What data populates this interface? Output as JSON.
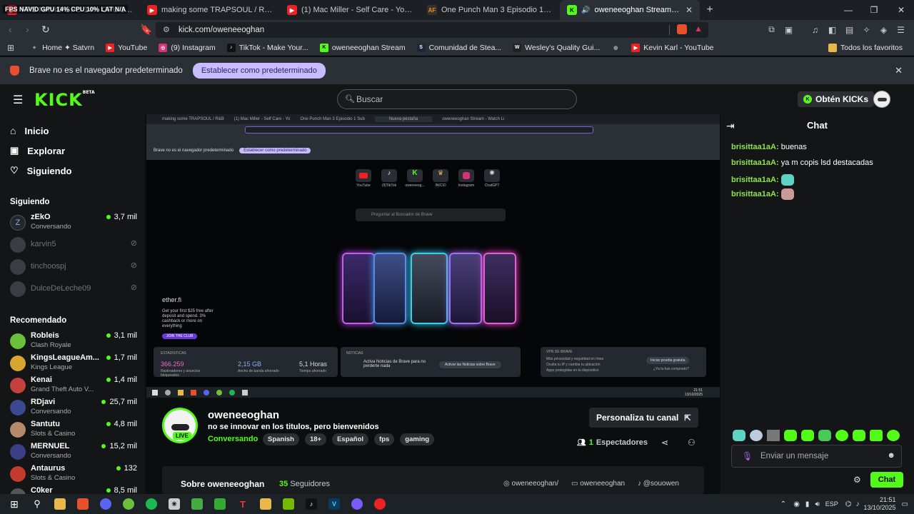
{
  "browser": {
    "tabs": [
      {
        "title": "FPS NAVID GPU 14% CPU 10% LAT N/A — BOUNCY BLLTZ - YouTube",
        "color": "#e22"
      },
      {
        "title": "making some TRAPSOUL / R&B - YouTube",
        "color": "#e22"
      },
      {
        "title": "(1) Mac Miller - Self Care - YouTube",
        "color": "#e22"
      },
      {
        "title": "One Punch Man 3 Episodio 1 Sub Esp",
        "color": "#555"
      },
      {
        "title": "oweneeoghan Stream - Watch Live on Kick",
        "color": "#53fc18"
      }
    ],
    "overlay_text": "FPS NAVID GPU 14% CPU 10% LAT N/A",
    "url": "kick.com/oweneeoghan",
    "bookmarks": [
      {
        "label": "Home ✦ Satvrn",
        "color": "#7a5"
      },
      {
        "label": "YouTube",
        "color": "#e22"
      },
      {
        "label": "(9) Instagram",
        "color": "#d3337a"
      },
      {
        "label": "TikTok - Make Your...",
        "color": "#111"
      },
      {
        "label": "oweneeoghan Stream",
        "color": "#53fc18"
      },
      {
        "label": "Comunidad de Stea...",
        "color": "#1b2838"
      },
      {
        "label": "Wesley's Quality Gui...",
        "color": "#222"
      },
      {
        "label": "",
        "color": "#555"
      },
      {
        "label": "Kevin Karl - YouTube",
        "color": "#e22"
      }
    ],
    "bookmarks_folder": "Todos los favoritos",
    "infobar_text": "Brave no es el navegador predeterminado",
    "infobar_button": "Establecer como predeterminado"
  },
  "kick": {
    "logo": "KICK",
    "logo_badge": "BETA",
    "search_placeholder": "Buscar",
    "get_kicks": "Obtén KICKs",
    "nav": [
      {
        "label": "Inicio",
        "icon": "home-icon"
      },
      {
        "label": "Explorar",
        "icon": "compass-icon"
      },
      {
        "label": "Siguiendo",
        "icon": "heart-icon"
      }
    ],
    "following_title": "Siguiendo",
    "following": [
      {
        "name": "zEkO",
        "category": "Conversando",
        "viewers": "3,7 mil",
        "online": true
      },
      {
        "name": "karvin5",
        "category": "",
        "viewers": "",
        "online": false
      },
      {
        "name": "tinchoospj",
        "category": "",
        "viewers": "",
        "online": false
      },
      {
        "name": "DulceDeLeche09",
        "category": "",
        "viewers": "",
        "online": false
      }
    ],
    "recommended_title": "Recomendado",
    "recommended": [
      {
        "name": "Robleis",
        "category": "Clash Royale",
        "viewers": "3,1 mil"
      },
      {
        "name": "KingsLeagueAm...",
        "category": "Kings League",
        "viewers": "1,7 mil"
      },
      {
        "name": "Kenai",
        "category": "Grand Theft Auto V...",
        "viewers": "1,4 mil"
      },
      {
        "name": "RDjavi",
        "category": "Conversando",
        "viewers": "25,7 mil"
      },
      {
        "name": "Santutu",
        "category": "Slots & Casino",
        "viewers": "4,8 mil"
      },
      {
        "name": "MERNUEL",
        "category": "Conversando",
        "viewers": "15,2 mil"
      },
      {
        "name": "Antaurus",
        "category": "Slots & Casino",
        "viewers": "132"
      },
      {
        "name": "C0ker",
        "category": "",
        "viewers": "8,5 mil"
      }
    ],
    "stream": {
      "channel": "oweneeoghan",
      "title": "no se innovar en los titulos, pero bienvenidos",
      "category": "Conversando",
      "tags": [
        "Spanish",
        "18+",
        "Español",
        "fps",
        "gaming"
      ],
      "live_badge": "LIVE",
      "customize_button": "Personaliza tu canal",
      "viewers_count": "1",
      "viewers_label": "Espectadores",
      "about_title": "Sobre oweneeoghan",
      "followers_count": "35",
      "followers_label": "Seguidores",
      "socials": [
        "oweneeoghan/",
        "oweneeoghan",
        "@souowen"
      ]
    },
    "chat": {
      "title": "Chat",
      "messages": [
        {
          "user": "brisittaa1aA:",
          "text": "buenas"
        },
        {
          "user": "brisittaa1aA:",
          "text": "ya m copis lsd destacadas"
        },
        {
          "user": "brisittaa1aA:",
          "text": ""
        },
        {
          "user": "brisittaa1aA:",
          "text": ""
        }
      ],
      "input_placeholder": "Enviar un mensaje",
      "send_button": "Chat"
    }
  },
  "video_content": {
    "inner_tabs": [
      "making some TRAPSOUL / R&B",
      "(1) Mac Miller - Self Care - Yo",
      "One Punch Man 3 Episodio 1 Sub",
      "Nueva pestaña",
      "oweneeoghan Stream - Watch Li"
    ],
    "inner_infobar": "Brave no es el navegador predeterminado",
    "inner_infobar_btn": "Establecer como predeterminado",
    "shortcuts": [
      "YouTube",
      "(9)TikTok",
      "oweneeog...",
      "INICIO",
      "Instagram",
      "ChatGPT"
    ],
    "search_text": "Preguntar al Buscador de Brave",
    "ad_brand": "ether.fi",
    "ad_text": "Get your first $25 free after deposit and spend. 3% cashback or more on everything",
    "ad_btn": "JOIN THE CLUB",
    "stats_title": "ESTADÍSTICAS",
    "stats": [
      {
        "value": "366.259",
        "label": "Rastreadores y anuncios bloqueados"
      },
      {
        "value": "2,15 GB",
        "label": "Ancho de banda ahorrado"
      },
      {
        "value": "5,1 Horas",
        "label": "Tiempo ahorrado"
      }
    ],
    "news_title": "NOTICIAS",
    "news_text": "Activa Noticias de Brave para no perderte nada",
    "news_btn": "Activar las Noticias sobre Brave",
    "vpn_title": "VPN DE BRAVE",
    "vpn_items": [
      "Más privacidad y seguridad en línea",
      "Oculta tu IP y cambia tu ubicación",
      "Apps protegidas en tu dispositivo"
    ],
    "vpn_btn": "Iniciar prueba gratuita",
    "vpn_link": "¿Ya la has comprado?",
    "clock": "21:51",
    "date": "13/10/2025"
  },
  "taskbar": {
    "lang": "ESP",
    "time": "21:51",
    "date": "13/10/2025"
  }
}
